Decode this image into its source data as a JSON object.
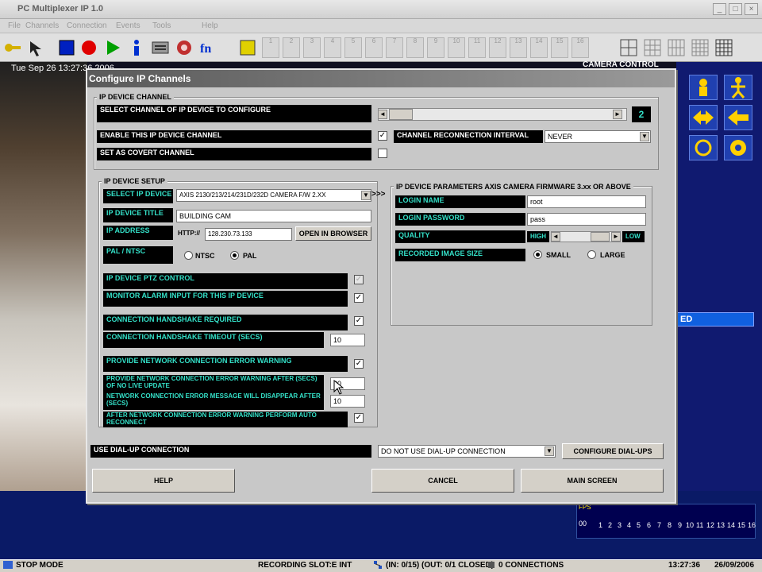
{
  "app": {
    "title": "PC Multiplexer IP 1.0",
    "menu": [
      "File",
      "Channels",
      "Connection",
      "Events",
      "Tools",
      "Help"
    ],
    "datetime": "Tue Sep 26  13:27:36  2006",
    "camera_control_label": "CAMERA CONTROL",
    "camera_slots": [
      "1",
      "2",
      "3",
      "4",
      "5",
      "6",
      "7",
      "8",
      "9",
      "10",
      "11",
      "12",
      "13",
      "14",
      "15",
      "16"
    ],
    "ed_label": "ED"
  },
  "dialog": {
    "title": "Configure IP Channels",
    "ip_device_channel": {
      "group_label": "IP DEVICE CHANNEL",
      "select_label": "SELECT CHANNEL OF IP DEVICE TO CONFIGURE",
      "channel_number": "2",
      "enable_label": "ENABLE THIS IP DEVICE CHANNEL",
      "enable_checked": "✓",
      "covert_label": "SET AS COVERT CHANNEL",
      "reconnect_label": "CHANNEL RECONNECTION INTERVAL",
      "reconnect_value": "NEVER"
    },
    "ip_device_setup": {
      "group_label": "IP DEVICE SETUP",
      "select_device_label": "SELECT IP DEVICE",
      "select_device_value": "AXIS 2130/213/214/231D/232D CAMERA F/W 2.XX",
      "more_button": ">>>",
      "title_label": "IP DEVICE TITLE",
      "title_value": "BUILDING CAM",
      "address_label": "IP ADDRESS",
      "address_prefix": "HTTP://",
      "address_value": "128.230.73.133",
      "open_browser_button": "OPEN IN BROWSER",
      "pal_ntsc_label": "PAL / NTSC",
      "ntsc_label": "NTSC",
      "pal_label": "PAL",
      "ptz_label": "IP DEVICE PTZ CONTROL",
      "monitor_alarm_label": "MONITOR ALARM INPUT FOR THIS IP DEVICE",
      "handshake_label": "CONNECTION HANDSHAKE REQUIRED",
      "handshake_timeout_label": "CONNECTION HANDSHAKE TIMEOUT (SECS)",
      "handshake_timeout_value": "10",
      "error_warning_label": "PROVIDE NETWORK CONNECTION ERROR WARNING",
      "error_warning_after_label": "PROVIDE NETWORK CONNECTION ERROR WARNING AFTER (SECS) OF NO LIVE UPDATE",
      "error_warning_after_value": "20",
      "error_disappear_label": "NETWORK CONNECTION ERROR MESSAGE WILL DISAPPEAR AFTER (SECS)",
      "error_disappear_value": "10",
      "auto_reconnect_label": "AFTER NETWORK CONNECTION ERROR WARNING PERFORM AUTO RECONNECT",
      "check_mark": "✓"
    },
    "ip_device_parameters": {
      "group_label": "IP DEVICE PARAMETERS AXIS CAMERA FIRMWARE 3.xx OR ABOVE",
      "login_name_label": "LOGIN NAME",
      "login_name_value": "root",
      "login_password_label": "LOGIN PASSWORD",
      "login_password_value": "pass",
      "quality_label": "QUALITY",
      "quality_high": "HIGH",
      "quality_low": "LOW",
      "recorded_size_label": "RECORDED IMAGE SIZE",
      "small_label": "SMALL",
      "large_label": "LARGE"
    },
    "dialup": {
      "label": "USE DIAL-UP CONNECTION",
      "value": "DO NOT USE DIAL-UP CONNECTION",
      "configure_button": "CONFIGURE DIAL-UPS"
    },
    "buttons": {
      "help": "HELP",
      "cancel": "CANCEL",
      "main_screen": "MAIN SCREEN"
    }
  },
  "graph": {
    "label": "FPS",
    "zero": "00",
    "axis": [
      "1",
      "2",
      "3",
      "4",
      "5",
      "6",
      "7",
      "8",
      "9",
      "10",
      "11",
      "12",
      "13",
      "14",
      "15",
      "16"
    ]
  },
  "statusbar": {
    "mode": "STOP MODE",
    "recording_slot": "RECORDING SLOT:E INT",
    "in_out": "(IN: 0/15)  (OUT: 0/1 CLOSED)",
    "connections": "0 CONNECTIONS",
    "time": "13:27:36",
    "date": "26/09/2006"
  }
}
